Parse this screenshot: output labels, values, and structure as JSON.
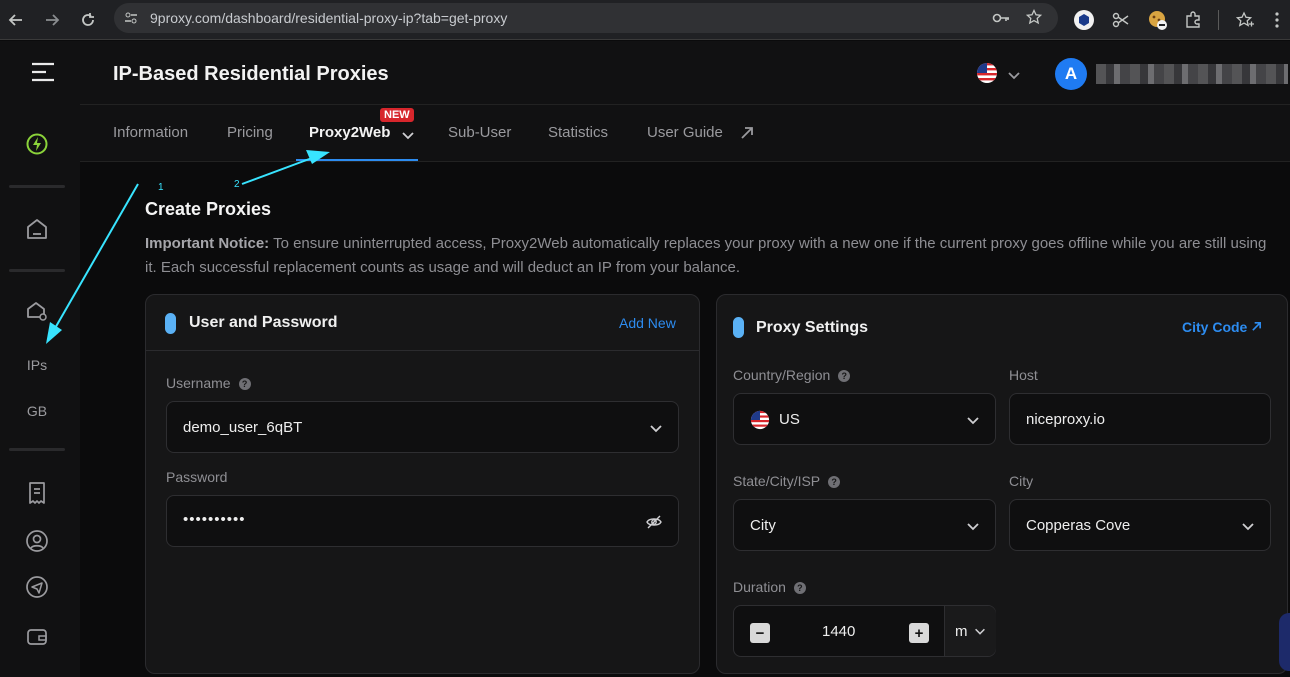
{
  "browser": {
    "url": "9proxy.com/dashboard/residential-proxy-ip?tab=get-proxy",
    "icons": [
      "back-icon",
      "forward-icon",
      "reload-icon",
      "site-info-icon",
      "key-icon",
      "star-icon",
      "extension-icons",
      "puzzle-icon",
      "bookmark-star-icon"
    ]
  },
  "header": {
    "title": "IP-Based Residential Proxies",
    "avatar_initial": "A"
  },
  "sidebar": {
    "items": [
      {
        "icon": "lightning-icon"
      },
      {
        "icon": "home-icon"
      },
      {
        "icon": "proxy-house-icon"
      },
      {
        "label": "IPs"
      },
      {
        "label": "GB"
      },
      {
        "icon": "receipt-icon"
      },
      {
        "icon": "user-icon"
      },
      {
        "icon": "telegram-icon"
      },
      {
        "icon": "wallet-icon"
      }
    ]
  },
  "tabs": [
    {
      "label": "Information"
    },
    {
      "label": "Pricing"
    },
    {
      "label": "Proxy2Web",
      "badge": "NEW",
      "active": true
    },
    {
      "label": "Sub-User"
    },
    {
      "label": "Statistics"
    },
    {
      "label": "User Guide"
    }
  ],
  "main": {
    "section_title": "Create Proxies",
    "notice_label": "Important Notice:",
    "notice_text": " To ensure uninterrupted access, Proxy2Web automatically replaces your proxy with a new one if the current proxy goes offline while you are still using it. Each successful replacement counts as usage and will deduct an IP from your balance."
  },
  "user_card": {
    "title": "User and Password",
    "add_new": "Add New",
    "username_label": "Username",
    "username_value": "demo_user_6qBT",
    "password_label": "Password",
    "password_value": "••••••••••"
  },
  "proxy_card": {
    "title": "Proxy Settings",
    "city_code": "City Code",
    "country_label": "Country/Region",
    "country_value": "US",
    "host_label": "Host",
    "host_value": "niceproxy.io",
    "state_label": "State/City/ISP",
    "state_value": "City",
    "city_label": "City",
    "city_value": "Copperas Cove",
    "duration_label": "Duration",
    "duration_value": "1440",
    "duration_unit": "m"
  },
  "annotations": {
    "arrow1_label": "1",
    "arrow2_label": "2"
  },
  "colors": {
    "accent": "#2d8cf0",
    "badge": "#d7262c",
    "lightning": "#8bd33a",
    "arrow": "#38e4ff"
  }
}
